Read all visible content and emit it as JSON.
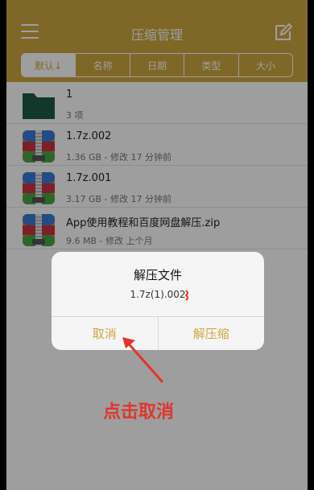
{
  "header": {
    "title": "压缩管理",
    "menu_icon": "menu-icon",
    "edit_icon": "edit-icon"
  },
  "sort_tabs": [
    {
      "label": "默认↓",
      "active": true
    },
    {
      "label": "名称",
      "active": false
    },
    {
      "label": "日期",
      "active": false
    },
    {
      "label": "类型",
      "active": false
    },
    {
      "label": "大小",
      "active": false
    }
  ],
  "files": [
    {
      "name": "1",
      "meta": "3 项",
      "icon": "folder-icon"
    },
    {
      "name": "1.7z.002",
      "meta": "1.36 GB - 修改 17 分钟前",
      "icon": "zip-archive-icon"
    },
    {
      "name": "1.7z.001",
      "meta": "3.17 GB - 修改 17 分钟前",
      "icon": "zip-archive-icon"
    },
    {
      "name": "App使用教程和百度网盘解压.zip",
      "meta": "9.6 MB - 修改 上个月",
      "icon": "zip-archive-icon"
    }
  ],
  "dialog": {
    "title": "解压文件",
    "message": "1.7z(1).002",
    "cancel_label": "取消",
    "extract_label": "解压缩"
  },
  "annotation": {
    "text": "点击取消"
  },
  "colors": {
    "accent": "#cea63f",
    "annotation_red": "#e1352c",
    "folder_green": "#1e5b46"
  }
}
